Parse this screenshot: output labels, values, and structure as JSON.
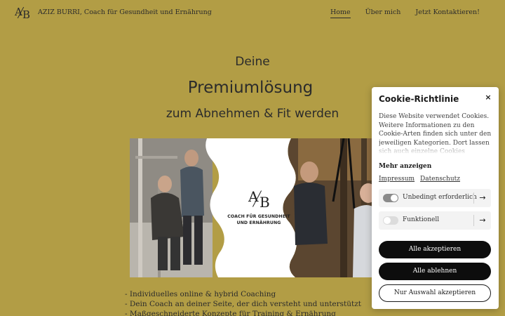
{
  "header": {
    "logo_text_a": "A",
    "logo_text_b": "B",
    "site_title": "AZIZ BURRI, Coach für Gesundheit und Ernährung",
    "nav": [
      {
        "label": "Home",
        "active": true
      },
      {
        "label": "Über mich",
        "active": false
      },
      {
        "label": "Jetzt Kontaktieren!",
        "active": false
      }
    ]
  },
  "hero": {
    "line1": "Deine",
    "line2": "Premiumlösung",
    "line3": "zum Abnehmen & Fit werden",
    "emblem_line1": "COACH FÜR GESUNDHEIT",
    "emblem_line2": "UND ERNÄHRUNG"
  },
  "bullets": [
    "- Individuelles online & hybrid Coaching",
    "- Dein Coach an deiner Seite, der dich versteht und unterstützt",
    "- Maßgeschneiderte Konzepte für Training & Ernährung"
  ],
  "cookie": {
    "title": "Cookie-Richtlinie",
    "close_symbol": "×",
    "description": "Diese Website verwendet Cookies. Weitere Informationen zu den Cookie-Arten finden sich unter den jeweiligen Kategorien. Dort lassen sich auch einzelne Cookies aktivieren. Die",
    "more_label": "Mehr anzeigen",
    "links": [
      "Impressum",
      "Datenschutz"
    ],
    "categories": [
      {
        "label": "Unbedingt erforderlich",
        "enabled": true
      },
      {
        "label": "Funktionell",
        "enabled": false
      }
    ],
    "arrow_symbol": "→",
    "accept_all": "Alle akzeptieren",
    "reject_all": "Alle ablehnen",
    "accept_selection": "Nur Auswahl akzeptieren"
  },
  "colors": {
    "background": "#b29d45",
    "text": "#2b2b2b",
    "button_dark": "#0d0d0d"
  }
}
